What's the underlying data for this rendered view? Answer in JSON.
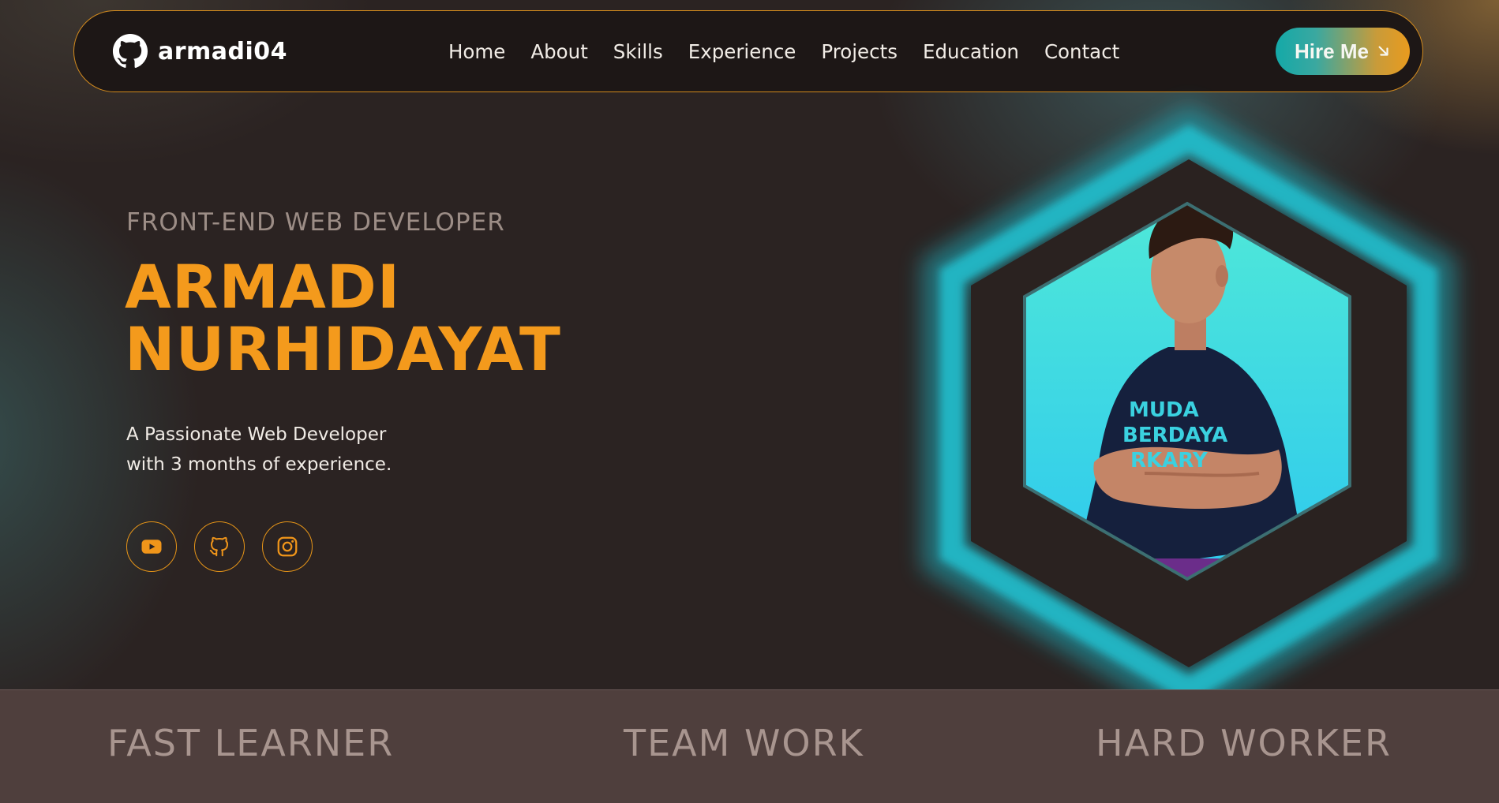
{
  "brand": {
    "name": "armadi04",
    "icon": "github-icon"
  },
  "nav": {
    "links": [
      "Home",
      "About",
      "Skills",
      "Experience",
      "Projects",
      "Education",
      "Contact"
    ],
    "hire_label": "Hire Me",
    "hire_icon": "arrow-down-right-icon"
  },
  "hero": {
    "role": "FRONT-END WEB DEVELOPER",
    "name_line1": "ARMADI",
    "name_line2": "NURHIDAYAT",
    "tagline_line1": "A Passionate Web Developer",
    "tagline_line2": "with 3 months of experience.",
    "socials": [
      "youtube-icon",
      "github-icon",
      "instagram-icon"
    ],
    "shirt_text_line1": "MUDA",
    "shirt_text_line2": "BERDAYA",
    "shirt_text_line3": "RKARY"
  },
  "traits": [
    "FAST LEARNER",
    "TEAM WORK",
    "HARD WORKER"
  ],
  "colors": {
    "accent": "#f49a1c",
    "background": "#2b2322",
    "band": "#4f3f3d",
    "teal_glow": "#1fb6c6"
  }
}
